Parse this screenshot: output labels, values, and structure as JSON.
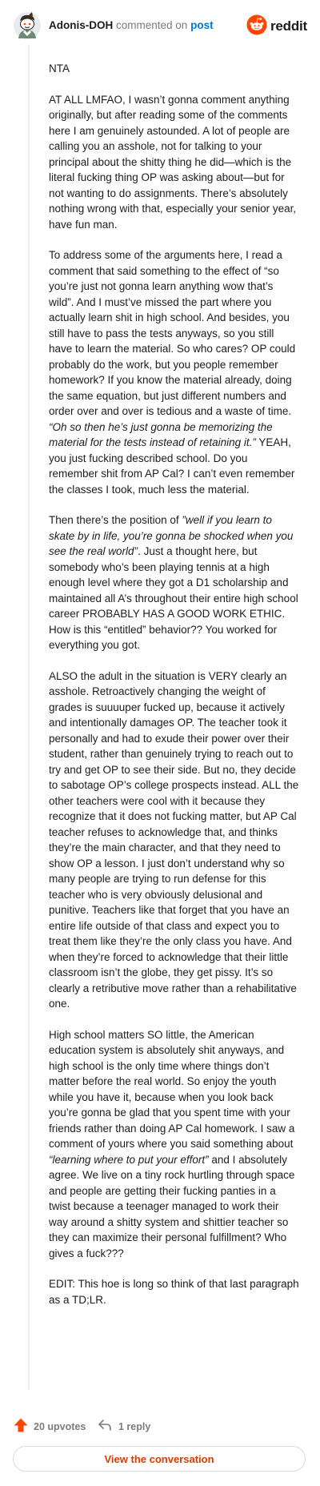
{
  "header": {
    "username": "Adonis-DOH",
    "verb": "commented on",
    "post_link": "post",
    "brand": "reddit"
  },
  "colors": {
    "reddit_orange": "#ff4500",
    "link_blue": "#0079d3",
    "button_text": "#d93a00",
    "muted": "#7c7c7c"
  },
  "comment": {
    "p1": "NTA",
    "p2": "AT ALL LMFAO, I wasn’t gonna comment anything originally, but after reading some of the comments here I am genuinely astounded. A lot of people are calling you an asshole, not for talking to your principal about the shitty thing he did—which is the literal fucking thing OP was asking about—but for not wanting to do assignments. There’s absolutely nothing wrong with that, especially your senior year, have fun man.",
    "p3a": "To address some of the arguments here, I read a comment that said something to the effect of “so you’re just not gonna learn anything wow that’s wild”. And I must’ve missed the part where you actually learn shit in high school. And besides, you still have to pass the tests anyways, so you still have to learn the material. So who cares? OP could probably do the work, but you people remember homework? If you know the material already, doing the same equation, but just different numbers and order over and over is tedious and a waste of time. ",
    "p3b": "“Oh so then he’s just gonna be memorizing the material for the tests instead of retaining it.”",
    "p3c": " YEAH, you just fucking described school. Do you remember shit from AP Cal? I can’t even remember the classes I took, much less the material.",
    "p4a": "Then there’s the position of ",
    "p4b": "”well if you learn to skate by in life, you’re gonna be shocked when you see the real world”",
    "p4c": ". Just a thought here, but somebody who’s been playing tennis at a high enough level where they got a D1 scholarship and maintained all A’s throughout their entire high school career PROBABLY HAS A GOOD WORK ETHIC. How is this “entitled” behavior?? You worked for everything you got.",
    "p5": "ALSO the adult in the situation is VERY clearly an asshole. Retroactively changing the weight of grades is suuuuper fucked up, because it actively and intentionally damages OP. The teacher took it personally and had to exude their power over their student, rather than genuinely trying to reach out to try and get OP to see their side. But no, they decide to sabotage OP’s college prospects instead. ALL the other teachers were cool with it because they recognize that it does not fucking matter, but AP Cal teacher refuses to acknowledge that, and thinks they’re the main character, and that they need to show OP a lesson. I just don’t understand why so many people are trying to run defense for this teacher who is very obviously delusional and punitive. Teachers like that forget that you have an entire life outside of that class and expect you to treat them like they’re the only class you have. And when they’re forced to acknowledge that their little classroom isn’t the globe, they get pissy. It’s so clearly a retributive move rather than a rehabilitative one.",
    "p6a": "High school matters SO little, the American education system is absolutely shit anyways, and high school is the only time where things don’t matter before the real world. So enjoy the youth while you have it, because when you look back you’re gonna be glad that you spent time with your friends rather than doing AP Cal homework. I saw a comment of yours where you said something about ",
    "p6b": "“learning where to put your effort”",
    "p6c": " and I absolutely agree. We live on a tiny rock hurtling through space and people are getting their fucking panties in a twist because a teenager managed to work their way around a shitty system and shittier teacher so they can maximize their personal fulfillment? Who gives a fuck???",
    "p7": "EDIT: This hoe is long so think of that last paragraph as a TD;LR."
  },
  "footer": {
    "upvotes": "20 upvotes",
    "replies": "1 reply",
    "view_button": "View the conversation"
  },
  "icons": {
    "avatar": "snoo-avatar-icon",
    "brand": "reddit-logo-icon",
    "upvote": "upvote-arrow-icon",
    "reply": "reply-arrow-icon"
  }
}
